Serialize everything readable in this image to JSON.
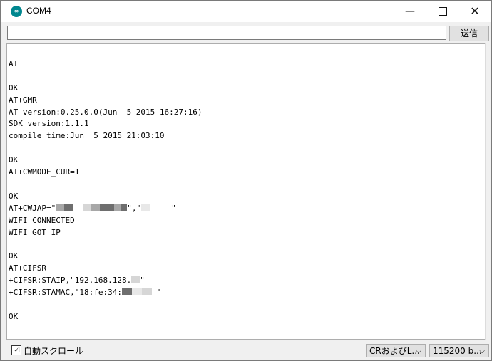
{
  "window": {
    "title": "COM4",
    "icon_text": "∞",
    "minimize": "—",
    "close": "✕"
  },
  "send": {
    "input_value": "",
    "button_label": "送信"
  },
  "output_lines": [
    "AT",
    "",
    "OK",
    "AT+GMR",
    "AT version:0.25.0.0(Jun  5 2015 16:27:16)",
    "SDK version:1.1.1",
    "compile time:Jun  5 2015 21:03:10",
    "",
    "OK",
    "AT+CWMODE_CUR=1",
    "",
    "OK",
    "AT+CWJAP=\"",
    "WIFI CONNECTED",
    "WIFI GOT IP",
    "",
    "OK",
    "AT+CIFSR",
    "+CIFSR:STAIP,\"192.168.128.",
    "+CIFSR:STAMAC,\"18:fe:34:",
    "",
    "OK"
  ],
  "output_fragments": {
    "cwjap_mid": "\",\"",
    "cwjap_end": "\"",
    "staip_end": "\"",
    "stamac_end": " \""
  },
  "bottom": {
    "autoscroll_checked": "☑",
    "autoscroll_label": "自動スクロール",
    "line_ending": "CRおよびL...",
    "baud_rate": "115200 b...",
    "dropdown_arrow": "⌵"
  }
}
